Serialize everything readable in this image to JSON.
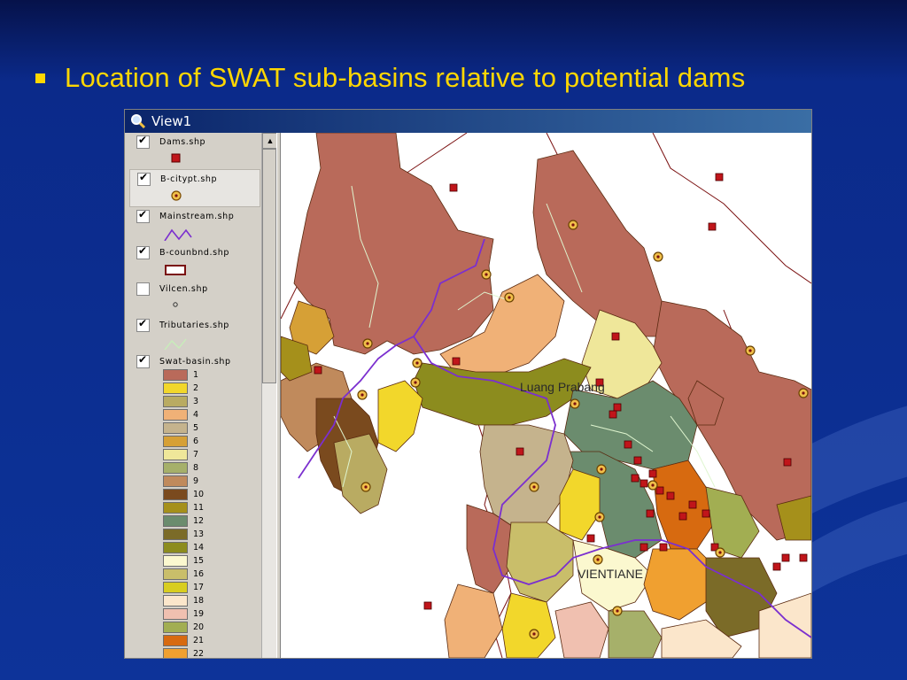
{
  "slide": {
    "title": "Location of SWAT sub-basins relative to potential dams",
    "bullet_color": "#ffd700"
  },
  "window": {
    "title": "View1",
    "icon": "magnifier-icon"
  },
  "toc": {
    "layers": [
      {
        "name": "Dams.shp",
        "checked": true,
        "symbol": "red-square"
      },
      {
        "name": "B-citypt.shp",
        "checked": true,
        "symbol": "city-point"
      },
      {
        "name": "Mainstream.shp",
        "checked": true,
        "symbol": "purple-line"
      },
      {
        "name": "B-counbnd.shp",
        "checked": true,
        "symbol": "country-boundary"
      },
      {
        "name": "Vilcen.shp",
        "checked": false,
        "symbol": "small-circle"
      },
      {
        "name": "Tributaries.shp",
        "checked": true,
        "symbol": "light-green-line"
      },
      {
        "name": "Swat-basin.shp",
        "checked": true,
        "symbol": "legend"
      }
    ],
    "basin_legend": [
      {
        "label": "1",
        "color": "#b96a5a"
      },
      {
        "label": "2",
        "color": "#f2d72b"
      },
      {
        "label": "3",
        "color": "#b9ab62"
      },
      {
        "label": "4",
        "color": "#f0b177"
      },
      {
        "label": "5",
        "color": "#c5b38d"
      },
      {
        "label": "6",
        "color": "#d6a036"
      },
      {
        "label": "7",
        "color": "#efe79a"
      },
      {
        "label": "8",
        "color": "#a6b06a"
      },
      {
        "label": "9",
        "color": "#c08a5c"
      },
      {
        "label": "10",
        "color": "#7a4a1e"
      },
      {
        "label": "11",
        "color": "#a5901b"
      },
      {
        "label": "12",
        "color": "#6b8c6e"
      },
      {
        "label": "13",
        "color": "#7b6b28"
      },
      {
        "label": "14",
        "color": "#8c8c1e"
      },
      {
        "label": "15",
        "color": "#fbf8cf"
      },
      {
        "label": "16",
        "color": "#c9be6a"
      },
      {
        "label": "17",
        "color": "#d8cd20"
      },
      {
        "label": "18",
        "color": "#fbe6cb"
      },
      {
        "label": "19",
        "color": "#f0c0b0"
      },
      {
        "label": "20",
        "color": "#a2ae52"
      },
      {
        "label": "21",
        "color": "#d76a10"
      },
      {
        "label": "22",
        "color": "#f0a030"
      }
    ]
  },
  "map": {
    "labels": {
      "luang_prabang": "Luang Prabang",
      "vientiane": "VIENTIANE"
    },
    "colors": {
      "dam": "#c0151a",
      "mainstream": "#7b2fcf",
      "boundary": "#7a1010",
      "city": "#d9a11e"
    }
  }
}
